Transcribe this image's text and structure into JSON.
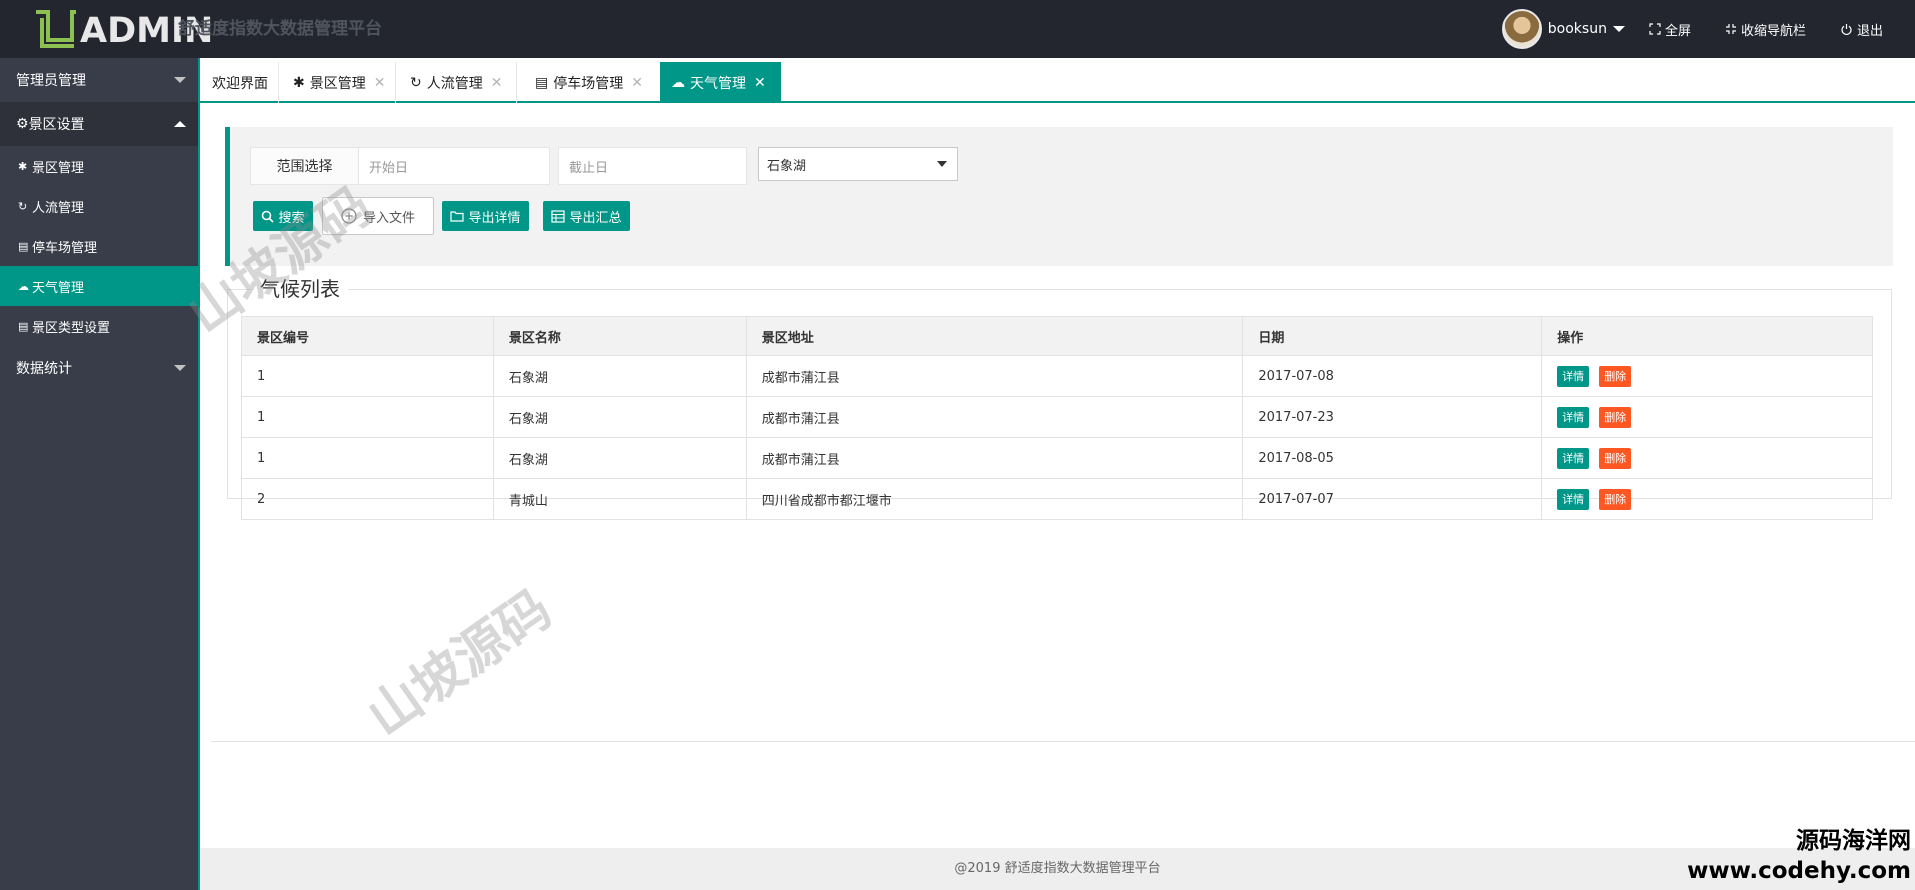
{
  "header": {
    "logo_text": "ADMIN",
    "site_title": "舒适度指数大数据管理平台",
    "user_name": "booksun",
    "fullscreen_label": "全屏",
    "collapse_label": "收缩导航栏",
    "logout_label": "退出"
  },
  "sidebar": {
    "groups": [
      {
        "label": "管理员管理"
      },
      {
        "label": "景区设置"
      },
      {
        "label": "数据统计"
      }
    ],
    "items": [
      {
        "label": "景区管理"
      },
      {
        "label": "人流管理"
      },
      {
        "label": "停车场管理"
      },
      {
        "label": "天气管理"
      },
      {
        "label": "景区类型设置"
      }
    ]
  },
  "tabs": [
    {
      "label": "欢迎界面"
    },
    {
      "label": "景区管理"
    },
    {
      "label": "人流管理"
    },
    {
      "label": "停车场管理"
    },
    {
      "label": "天气管理"
    }
  ],
  "search": {
    "range_label": "范围选择",
    "start_placeholder": "开始日",
    "end_placeholder": "截止日",
    "scenic_selected": "石象湖",
    "search_button": "搜索",
    "import_button": "导入文件",
    "export_detail_button": "导出详情",
    "export_summary_button": "导出汇总"
  },
  "list": {
    "title": "气候列表",
    "columns": [
      "景区编号",
      "景区名称",
      "景区地址",
      "日期",
      "操作"
    ],
    "rows": [
      {
        "id": "1",
        "name": "石象湖",
        "address": "成都市蒲江县",
        "date": "2017-07-08"
      },
      {
        "id": "1",
        "name": "石象湖",
        "address": "成都市蒲江县",
        "date": "2017-07-23"
      },
      {
        "id": "1",
        "name": "石象湖",
        "address": "成都市蒲江县",
        "date": "2017-08-05"
      },
      {
        "id": "2",
        "name": "青城山",
        "address": "四川省成都市都江堰市",
        "date": "2017-07-07"
      }
    ],
    "detail_label": "详情",
    "delete_label": "删除"
  },
  "footer": {
    "text": "@2019 舒适度指数大数据管理平台"
  },
  "watermark": {
    "text": "山坡源码",
    "corner_line1": "源码海洋网",
    "corner_line2": "www.codehy.com"
  },
  "colors": {
    "accent": "#009688",
    "danger": "#ff5722",
    "header_bg": "#23262e",
    "sidebar_bg": "#393d49"
  }
}
